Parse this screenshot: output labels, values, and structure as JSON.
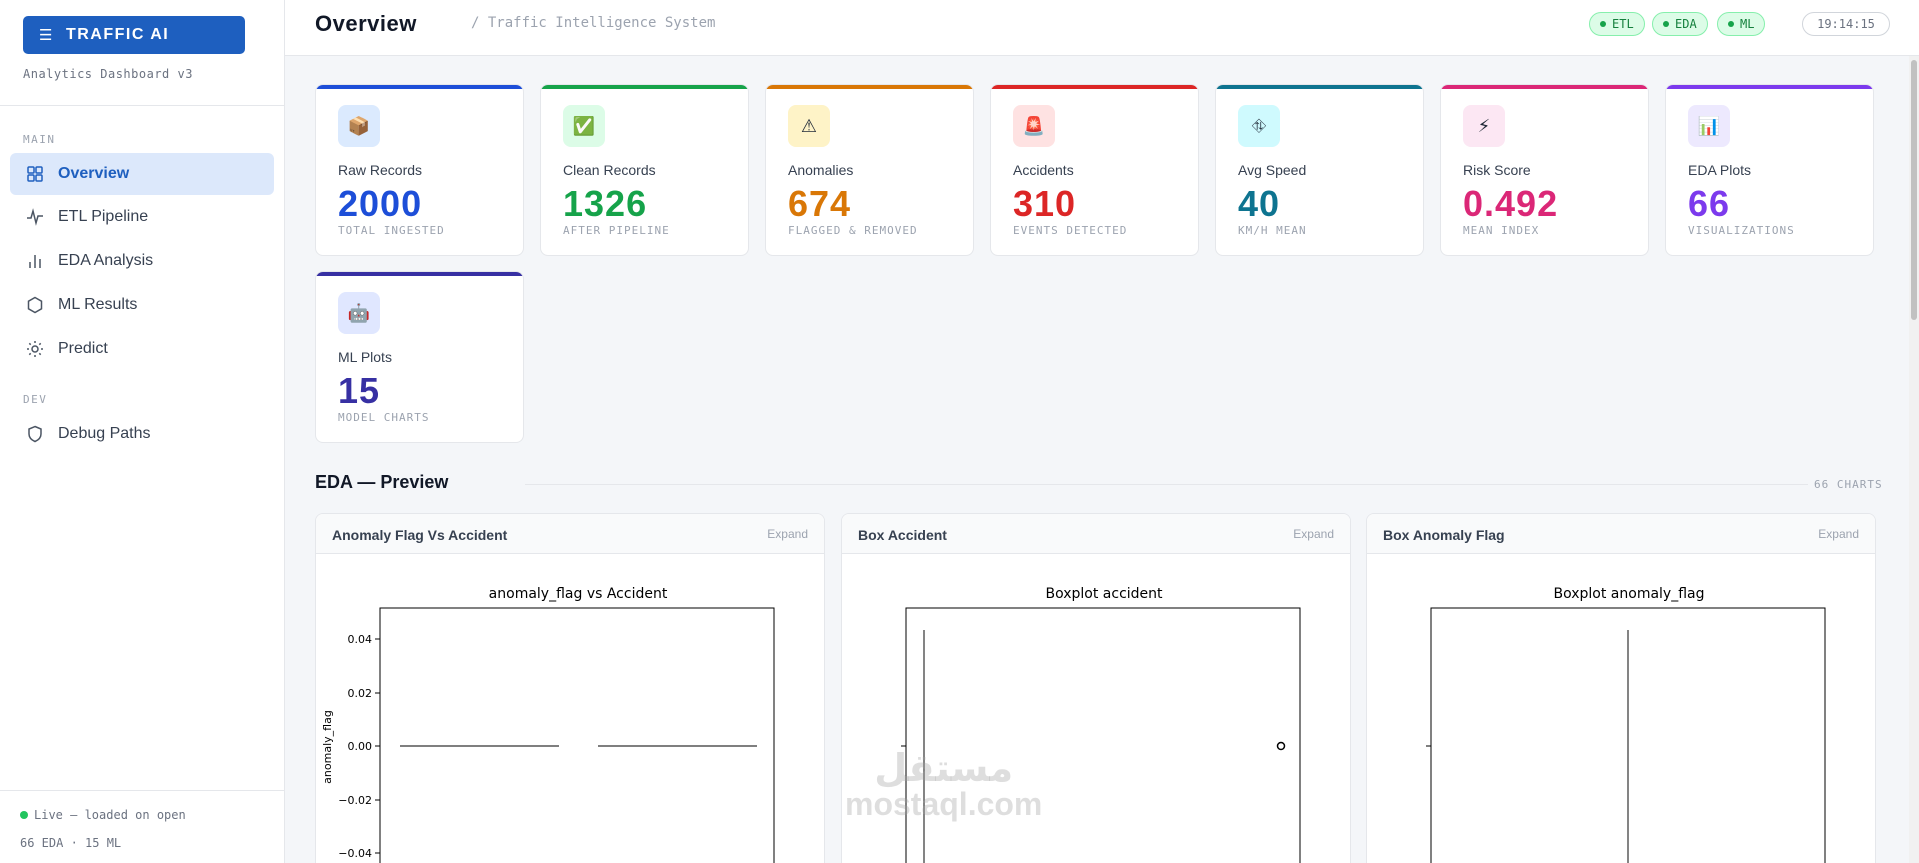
{
  "brand": {
    "name": "TRAFFIC AI",
    "subtitle": "Analytics Dashboard v3"
  },
  "sidebar": {
    "main_label": "MAIN",
    "dev_label": "DEV",
    "items": [
      {
        "label": "Overview",
        "icon": "grid-icon",
        "active": true
      },
      {
        "label": "ETL Pipeline",
        "icon": "pulse-icon",
        "active": false
      },
      {
        "label": "EDA Analysis",
        "icon": "bar-chart-icon",
        "active": false
      },
      {
        "label": "ML Results",
        "icon": "hexagon-icon",
        "active": false
      },
      {
        "label": "Predict",
        "icon": "sun-icon",
        "active": false
      }
    ],
    "dev_items": [
      {
        "label": "Debug Paths",
        "icon": "shield-icon"
      }
    ],
    "footer_status": "Live — loaded on open",
    "footer_counts": "66 EDA · 15 ML"
  },
  "header": {
    "title": "Overview",
    "subtitle": "/ Traffic Intelligence System",
    "pills": [
      "ETL",
      "EDA",
      "ML"
    ],
    "time": "19:14:15"
  },
  "stats": [
    {
      "label": "Raw Records",
      "value": "2000",
      "sub": "TOTAL INGESTED",
      "color": "#1d4ed8",
      "icon_bg": "#dbeafe",
      "icon": "box-icon",
      "glyph": "📦"
    },
    {
      "label": "Clean Records",
      "value": "1326",
      "sub": "AFTER PIPELINE",
      "color": "#16a34a",
      "icon_bg": "#dcfce7",
      "icon": "check-icon",
      "glyph": "✅"
    },
    {
      "label": "Anomalies",
      "value": "674",
      "sub": "FLAGGED & REMOVED",
      "color": "#d97706",
      "icon_bg": "#fef3c7",
      "icon": "warning-icon",
      "glyph": "⚠"
    },
    {
      "label": "Accidents",
      "value": "310",
      "sub": "EVENTS DETECTED",
      "color": "#dc2626",
      "icon_bg": "#fee2e2",
      "icon": "siren-icon",
      "glyph": "🚨"
    },
    {
      "label": "Avg Speed",
      "value": "40",
      "sub": "KM/H MEAN",
      "color": "#0e7490",
      "icon_bg": "#cffafe",
      "icon": "speed-icon",
      "glyph": "⛗"
    },
    {
      "label": "Risk Score",
      "value": "0.492",
      "sub": "MEAN INDEX",
      "color": "#db2777",
      "icon_bg": "#fce7f3",
      "icon": "lightning-icon",
      "glyph": "⚡"
    },
    {
      "label": "EDA Plots",
      "value": "66",
      "sub": "VISUALIZATIONS",
      "color": "#7c3aed",
      "icon_bg": "#ede9fe",
      "icon": "chart-icon",
      "glyph": "📊"
    },
    {
      "label": "ML Plots",
      "value": "15",
      "sub": "MODEL CHARTS",
      "color": "#3730a3",
      "icon_bg": "#e0e7ff",
      "icon": "robot-icon",
      "glyph": "🤖"
    }
  ],
  "section": {
    "title": "EDA — Preview",
    "count": "66 CHARTS"
  },
  "panels": [
    {
      "title": "Anomaly Flag Vs Accident",
      "expand": "Expand",
      "plot_title": "anomaly_flag vs Accident",
      "ylabel": "anomaly_flag",
      "ticks": [
        "0.04",
        "0.02",
        "0.00",
        "−0.02",
        "−0.04"
      ]
    },
    {
      "title": "Box Accident",
      "expand": "Expand",
      "plot_title": "Boxplot accident"
    },
    {
      "title": "Box Anomaly Flag",
      "expand": "Expand",
      "plot_title": "Boxplot anomaly_flag"
    }
  ],
  "watermark": {
    "line1": "مستقل",
    "line2": "mostaql.com"
  }
}
